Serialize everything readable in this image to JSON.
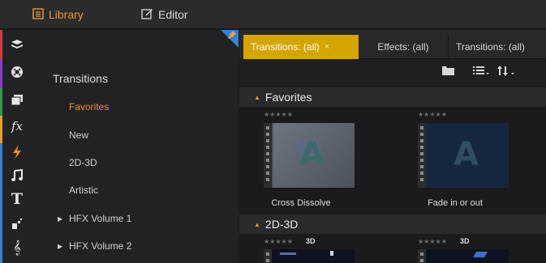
{
  "topbar": {
    "library_label": "Library",
    "editor_label": "Editor"
  },
  "rail": {
    "icons": [
      "project-bin-icon",
      "disc-icon",
      "collections-icon",
      "effects-fx-icon",
      "transitions-bolt-icon",
      "music-note-icon",
      "title-t-icon",
      "montage-icon",
      "sound-effects-icon"
    ],
    "stripe_colors": [
      "#d23a3a",
      "#8a3ccf",
      "#2d9a44",
      "#e89a2c",
      "#3b7fd0"
    ]
  },
  "catpanel": {
    "title": "Transitions",
    "items": [
      {
        "label": "Favorites",
        "active": true,
        "expandable": false
      },
      {
        "label": "New",
        "active": false,
        "expandable": false
      },
      {
        "label": "2D-3D",
        "active": false,
        "expandable": false
      },
      {
        "label": "Artistic",
        "active": false,
        "expandable": false
      },
      {
        "label": "HFX Volume 1",
        "active": false,
        "expandable": true
      },
      {
        "label": "HFX Volume 2",
        "active": false,
        "expandable": true
      }
    ]
  },
  "tabs": {
    "items": [
      {
        "label": "Transitions: (all)",
        "close": "×",
        "active": true
      },
      {
        "label": "Effects: (all)",
        "active": false
      },
      {
        "label": "Transitions: (all)",
        "active": false
      }
    ]
  },
  "toolbar": {
    "icons": [
      "folder-icon",
      "list-view-icon",
      "sort-icon"
    ]
  },
  "sections": [
    {
      "title": "Favorites",
      "items": [
        {
          "label": "Cross Dissolve",
          "stars": "★★★★★",
          "badge": ""
        },
        {
          "label": "Fade in or out",
          "stars": "★★★★★",
          "badge": ""
        }
      ]
    },
    {
      "title": "2D-3D",
      "items": [
        {
          "label": "",
          "stars": "★★★★★",
          "badge": "3D"
        },
        {
          "label": "",
          "stars": "★★★★★",
          "badge": "3D"
        }
      ]
    }
  ],
  "colors": {
    "accent": "#e89a2c",
    "active_tab": "#d5a400",
    "pin_corner": "#3b7fd0"
  }
}
